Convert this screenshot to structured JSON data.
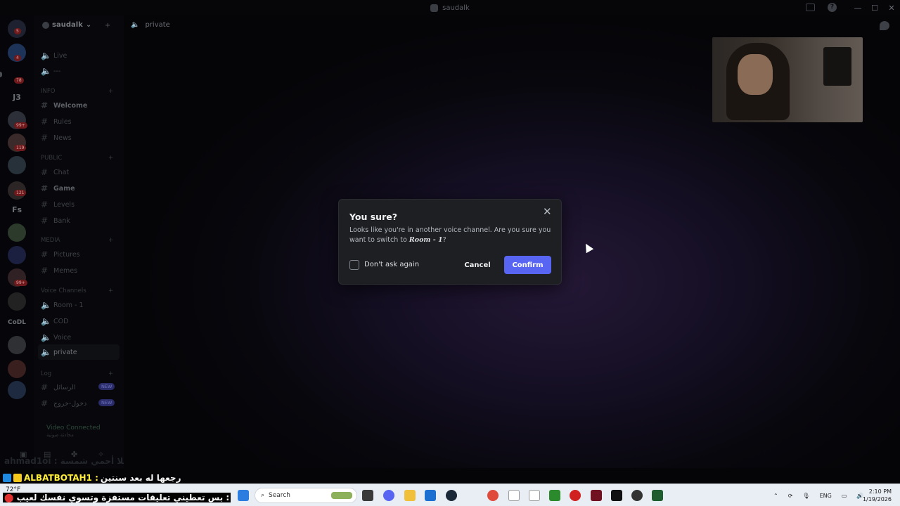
{
  "window": {
    "title": "saudalk",
    "controls": [
      "—",
      "☐",
      "✕"
    ]
  },
  "servers": {
    "badges": [
      "5",
      "4",
      "78",
      "99+",
      "119",
      "121",
      "99+"
    ],
    "text_icons": [
      "J3",
      "Fs",
      "CoDL"
    ]
  },
  "sidebar": {
    "server_name": "saudalk",
    "channels": [
      {
        "icon": "#",
        "label": "Live"
      },
      {
        "icon": "#",
        "label": "---"
      }
    ],
    "categories": {
      "info": "INFO",
      "public": "PUBLIC",
      "media": "MEDIA",
      "voice": "Voice Channels",
      "log": "Log"
    },
    "info_channels": [
      "Welcome",
      "Rules",
      "News"
    ],
    "public_channels": [
      "Chat",
      "Game",
      "Levels",
      "Bank"
    ],
    "media_channels": [
      "Pictures",
      "Memes"
    ],
    "voice_channels": [
      "Room - 1",
      "COD",
      "Voice",
      "private"
    ],
    "log_channels": [
      "الرسائل",
      "دخول-خروج"
    ],
    "new_label": "NEW",
    "voice_connected": "Video Connected",
    "voice_sub": "محادثة صوتية"
  },
  "main": {
    "channel_name": "private"
  },
  "modal": {
    "title": "You sure?",
    "body_prefix": "Looks like you're in another voice channel. Are you sure you want to switch to",
    "channel": "Room - 1",
    "body_suffix": "?",
    "checkbox_label": "Don't ask again",
    "cancel": "Cancel",
    "confirm": "Confirm",
    "accent": "#5865f2"
  },
  "overlay": {
    "line1": "ahmad1oi : أبو هلا أحمي شمسة",
    "line2_user": "ALBATBOTAH1 :",
    "line2_msg": "رجعها له بعد سنتين",
    "ticker": "بس تعطيني تعليقات مستفزة وتسوي نفسك لعيب :"
  },
  "taskbar": {
    "weather": "72°F",
    "search_placeholder": "Search",
    "lang": "ENG",
    "time": "2:10 PM",
    "date": "1/19/2026"
  }
}
